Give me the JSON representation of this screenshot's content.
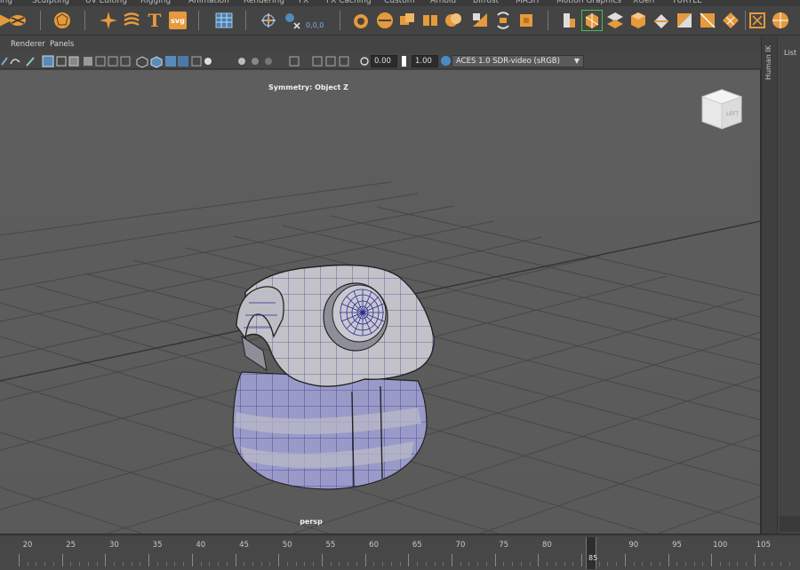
{
  "shelf_tabs": [
    "ing",
    "Sculpting",
    "UV Editing",
    "Rigging",
    "Animation",
    "Rendering",
    "FX",
    "FX Caching",
    "Custom",
    "Arnold",
    "Bifrost",
    "MASH",
    "Motion Graphics",
    "XGen",
    "TURTLE"
  ],
  "shelf": {
    "text_tool_glyph": "T",
    "svg_tool_label": "svg",
    "coordinate_readout": "0,0,0"
  },
  "panel_menu": {
    "renderer": "Renderer",
    "panels": "Panels"
  },
  "panel_toolbar": {
    "exposure_value": "0.00",
    "gamma_value": "1.00",
    "color_space": "ACES 1.0 SDR-video (sRGB)"
  },
  "viewport": {
    "symmetry_label": "Symmetry: Object Z",
    "camera_label": "persp",
    "view_cube_face": "LEFT"
  },
  "right_panel": {
    "human_ik_label": "Human IK",
    "list_label": "List"
  },
  "timeline": {
    "ticks": [
      "20",
      "25",
      "30",
      "35",
      "40",
      "45",
      "50",
      "55",
      "60",
      "65",
      "70",
      "75",
      "80",
      "85",
      "90",
      "95",
      "100",
      "105"
    ],
    "current_frame": "85",
    "playhead_label": "85"
  },
  "colors": {
    "shelf_accent": "#e59a3c",
    "wire_color": "#2a2a8c",
    "selected_shelf_icon": "#48c048"
  }
}
